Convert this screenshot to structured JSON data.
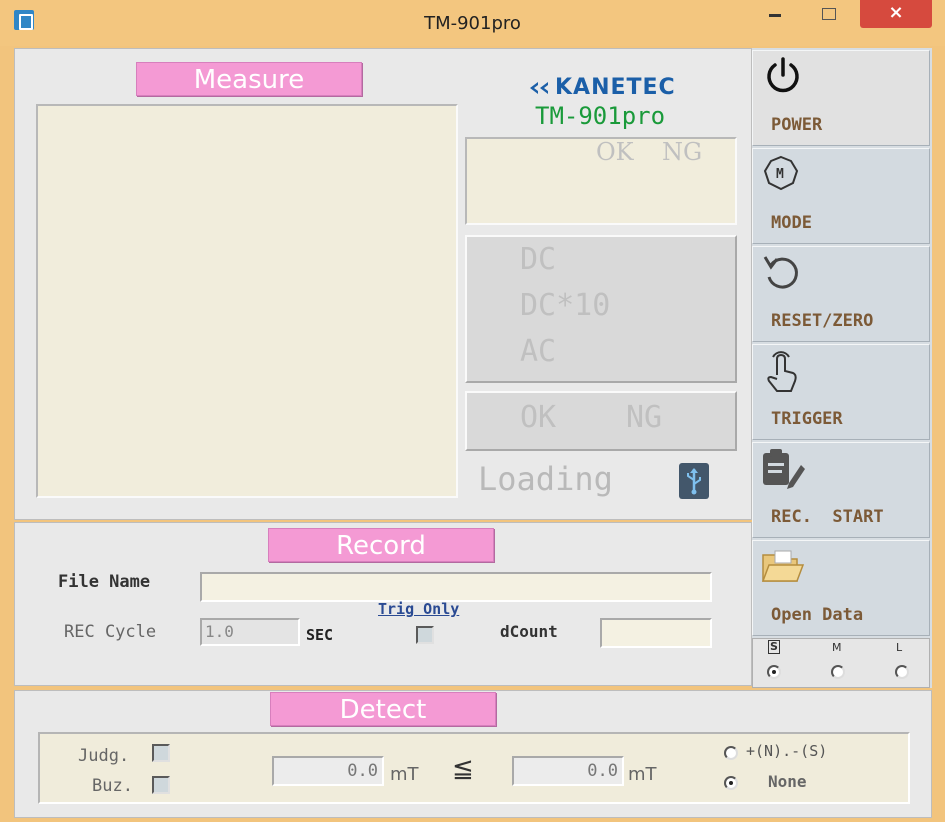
{
  "window": {
    "title": "TM-901pro",
    "close_glyph": "×"
  },
  "measure": {
    "label": "Measure",
    "brand": "KANETEC",
    "model": "TM-901pro",
    "judge_ok": "OK",
    "judge_ng": "NG",
    "modes": [
      "DC",
      "DC*10",
      "AC"
    ],
    "ok_label": "OK",
    "ng_label": "NG",
    "status": "Loading"
  },
  "sidebar": {
    "buttons": [
      {
        "label": "POWER",
        "icon": "power-icon"
      },
      {
        "label": "MODE",
        "icon": "mode-m-icon"
      },
      {
        "label": "RESET/ZERO",
        "icon": "reset-icon"
      },
      {
        "label": "TRIGGER",
        "icon": "touch-icon"
      },
      {
        "label": "REC.  START",
        "icon": "record-clipboard-icon"
      },
      {
        "label": "Open Data",
        "icon": "folder-open-icon"
      }
    ],
    "speed": {
      "options": [
        "S",
        "M",
        "L"
      ],
      "selected": "S"
    }
  },
  "record": {
    "label": "Record",
    "file_name_label": "File Name",
    "file_name_value": "",
    "rec_cycle_label": "REC Cycle",
    "rec_cycle_value": "1.0",
    "sec_label": "SEC",
    "trig_only_label": "Trig Only",
    "trig_only_checked": false,
    "dcount_label": "dCount",
    "dcount_value": ""
  },
  "detect": {
    "label": "Detect",
    "judg_label": "Judg.",
    "buz_label": "Buz.",
    "lower_value": "0.0",
    "upper_value": "0.0",
    "unit": "mT",
    "compare_symbol": "≦",
    "polarity_options": [
      "+(N).-(S)",
      "None"
    ],
    "polarity_selected": "None"
  },
  "colors": {
    "titlebar": "#f3c67f",
    "pink": "#f49ad4",
    "brand_blue": "#1b5fa8",
    "model_green": "#1a9a3a",
    "label_brown": "#7c5a37"
  }
}
